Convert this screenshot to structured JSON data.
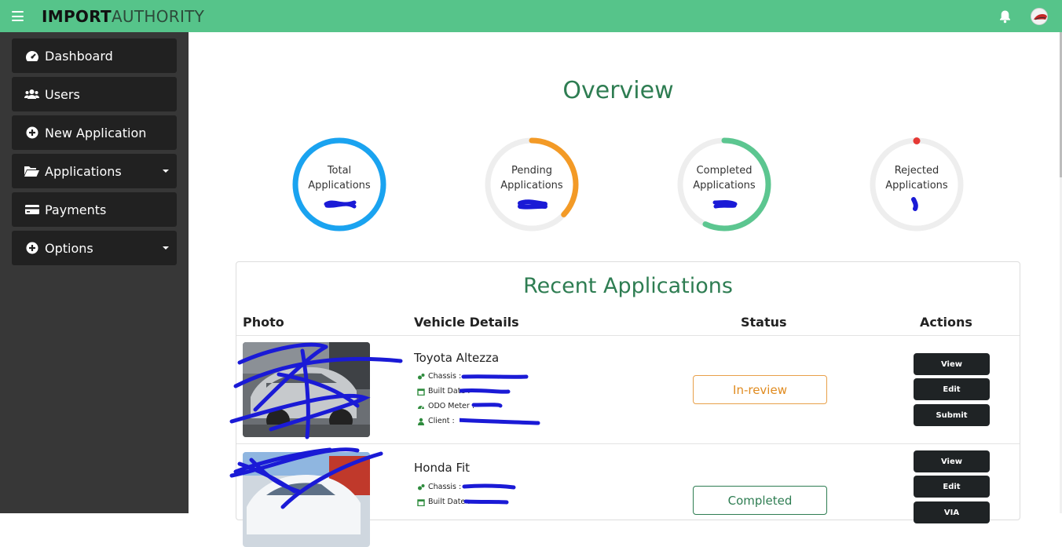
{
  "header": {
    "brand_bold": "IMPORT",
    "brand_light": "AUTHORITY",
    "icons": [
      "menu-icon",
      "bell-icon",
      "avatar"
    ],
    "accent_color": "#56c48a"
  },
  "sidebar": {
    "items": [
      {
        "label": "Dashboard",
        "icon": "dashboard-icon",
        "has_caret": false
      },
      {
        "label": "Users",
        "icon": "users-icon",
        "has_caret": false
      },
      {
        "label": "New Application",
        "icon": "plus-circle-icon",
        "has_caret": false
      },
      {
        "label": "Applications",
        "icon": "folder-open-icon",
        "has_caret": true
      },
      {
        "label": "Payments",
        "icon": "credit-card-icon",
        "has_caret": false
      },
      {
        "label": "Options",
        "icon": "plus-circle-icon",
        "has_caret": true
      }
    ]
  },
  "overview": {
    "title": "Overview",
    "stats": [
      {
        "line1": "Total",
        "line2": "Applications",
        "value": "",
        "progress": 1.0,
        "color": "#1aa3f0"
      },
      {
        "line1": "Pending",
        "line2": "Applications",
        "value": "",
        "progress": 0.37,
        "color": "#f39a26"
      },
      {
        "line1": "Completed",
        "line2": "Applications",
        "value": "",
        "progress": 0.57,
        "color": "#5cc690"
      },
      {
        "line1": "Rejected",
        "line2": "Applications",
        "value": "",
        "progress": 0.0,
        "color": "#e53935"
      }
    ]
  },
  "recent": {
    "title": "Recent Applications",
    "columns": [
      "Photo",
      "Vehicle Details",
      "Status",
      "Actions"
    ],
    "rows": [
      {
        "name": "Toyota Altezza",
        "details": [
          {
            "label": "Chassis :",
            "icon": "cogs-icon"
          },
          {
            "label": "Built Date :",
            "icon": "calendar-icon"
          },
          {
            "label": "ODO Meter :",
            "icon": "speedometer-icon"
          },
          {
            "label": "Client :",
            "icon": "user-icon"
          }
        ],
        "status": "In-review",
        "actions": [
          "View",
          "Edit",
          "Submit"
        ]
      },
      {
        "name": "Honda Fit",
        "details": [
          {
            "label": "Chassis :",
            "icon": "cogs-icon"
          },
          {
            "label": "Built Date :",
            "icon": "calendar-icon"
          }
        ],
        "status": "Completed",
        "actions": [
          "View",
          "Edit",
          "VIA"
        ]
      }
    ]
  }
}
